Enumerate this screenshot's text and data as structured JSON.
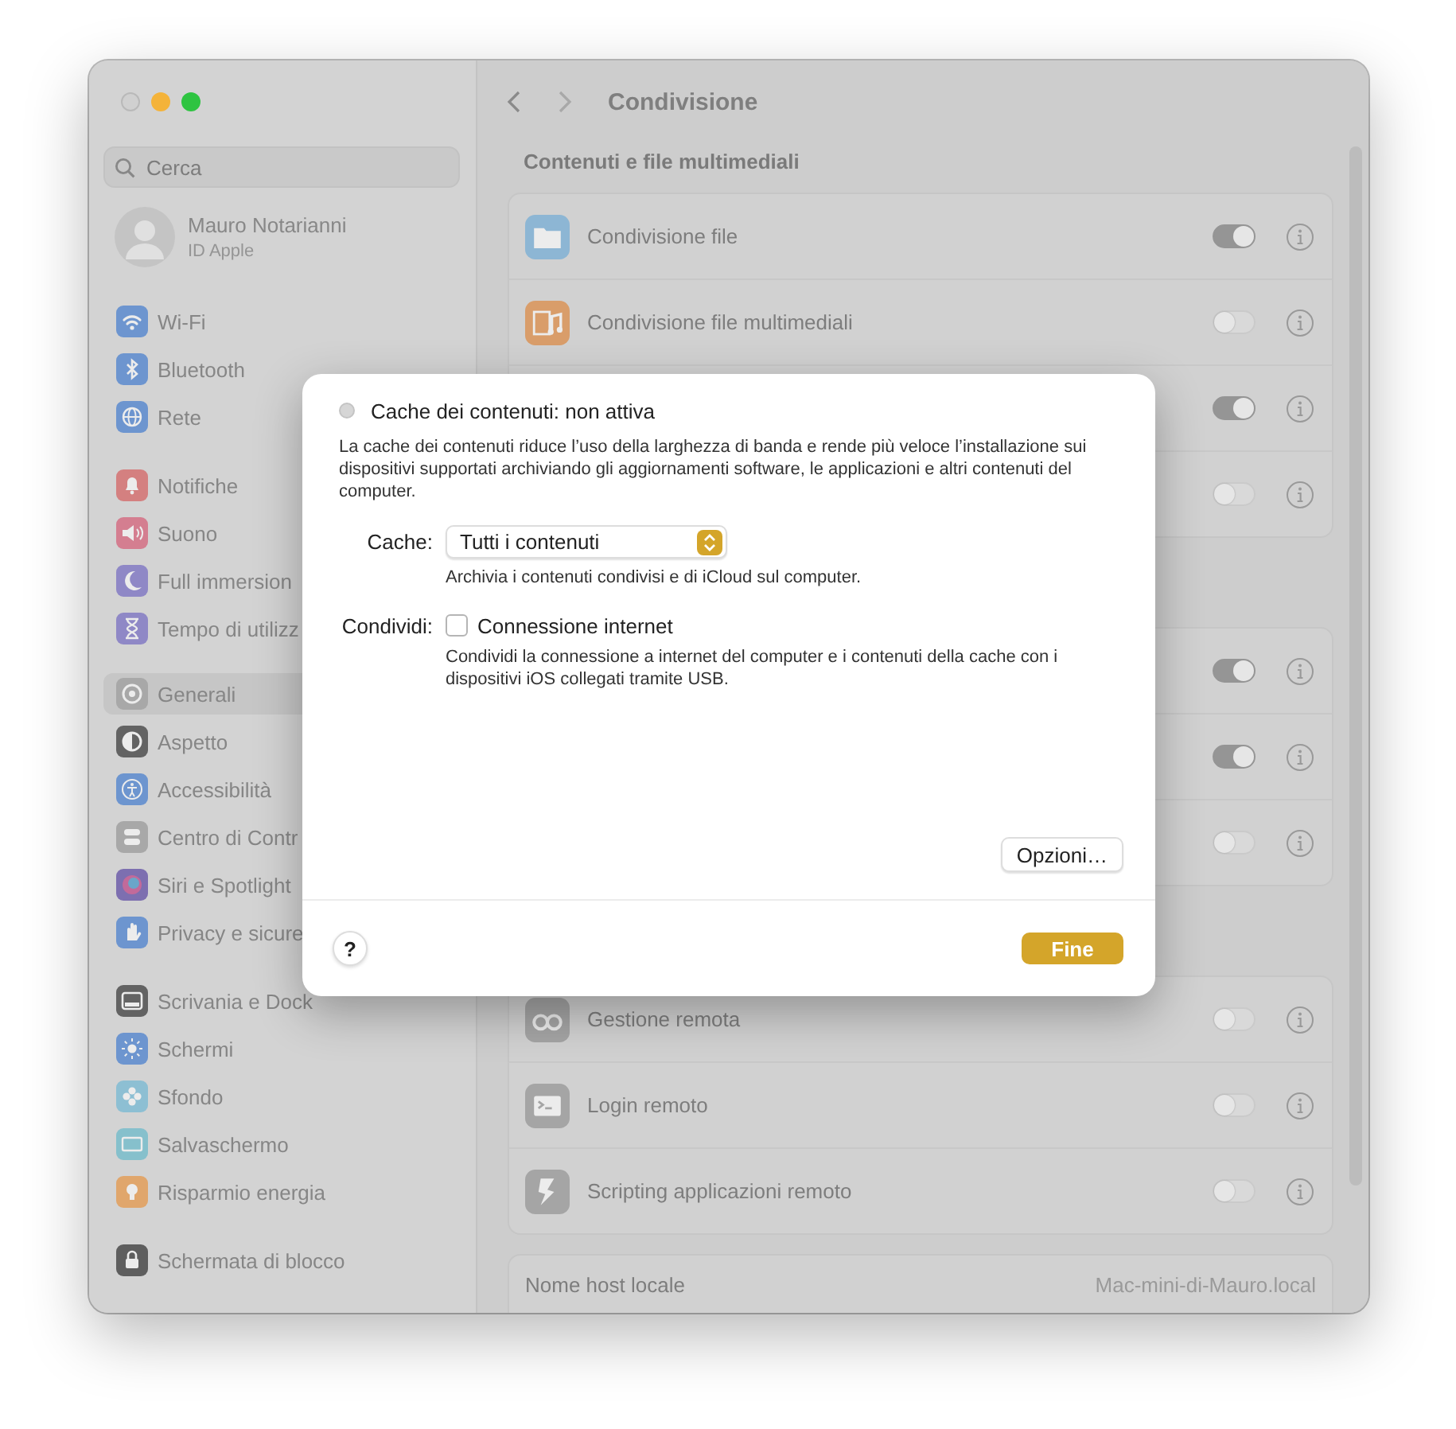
{
  "window": {
    "traffic_lights": [
      {
        "color": "#d0d0d0"
      },
      {
        "color": "#f4b33a"
      },
      {
        "color": "#2ec441"
      }
    ]
  },
  "sidebar": {
    "search": {
      "placeholder": "Cerca"
    },
    "profile": {
      "name": "Mauro Notarianni",
      "subtitle": "ID Apple"
    },
    "groups": [
      {
        "items": [
          {
            "label": "Wi-Fi",
            "selected": false
          },
          {
            "label": "Bluetooth",
            "selected": false
          },
          {
            "label": "Rete",
            "selected": false
          }
        ]
      },
      {
        "items": [
          {
            "label": "Notifiche",
            "selected": false
          },
          {
            "label": "Suono",
            "selected": false
          },
          {
            "label": "Full immersion",
            "selected": false
          },
          {
            "label": "Tempo di utilizz",
            "selected": false
          }
        ]
      },
      {
        "items": [
          {
            "label": "Generali",
            "selected": true
          },
          {
            "label": "Aspetto",
            "selected": false
          },
          {
            "label": "Accessibilità",
            "selected": false
          },
          {
            "label": "Centro di Contr",
            "selected": false
          },
          {
            "label": "Siri e Spotlight",
            "selected": false
          },
          {
            "label": "Privacy e sicure",
            "selected": false
          }
        ]
      },
      {
        "items": [
          {
            "label": "Scrivania e Dock",
            "selected": false
          },
          {
            "label": "Schermi",
            "selected": false
          },
          {
            "label": "Sfondo",
            "selected": false
          },
          {
            "label": "Salvaschermo",
            "selected": false
          },
          {
            "label": "Risparmio energia",
            "selected": false
          }
        ]
      },
      {
        "items": [
          {
            "label": "Schermata di blocco",
            "selected": false
          }
        ]
      }
    ]
  },
  "main": {
    "title": "Condivisione",
    "sections": [
      {
        "heading": "Contenuti e file multimediali",
        "rows": [
          {
            "label": "Condivisione file",
            "on": true
          },
          {
            "label": "Condivisione file multimediali",
            "on": false
          },
          {
            "on": true
          },
          {
            "on": false
          }
        ]
      },
      {
        "rows": [
          {
            "on": true
          },
          {
            "on": true
          },
          {
            "on": false
          }
        ]
      },
      {
        "rows": [
          {
            "label": "Gestione remota",
            "on": false
          },
          {
            "label": "Login remoto",
            "on": false
          },
          {
            "label": "Scripting applicazioni remoto",
            "on": false
          }
        ]
      }
    ],
    "host": {
      "label": "Nome host locale",
      "value": "Mac-mini-di-Mauro.local"
    }
  },
  "sheet": {
    "status": {
      "text": "Cache dei contenuti: non attiva",
      "active": false
    },
    "description": "La cache dei contenuti riduce l’uso della larghezza di banda e rende più veloce l’installazione sui dispositivi supportati archiviando gli aggiornamenti software, le applicazioni e altri contenuti del computer.",
    "cache": {
      "label": "Cache:",
      "value": "Tutti i contenuti",
      "hint": "Archivia i contenuti condivisi e di iCloud sul computer."
    },
    "share": {
      "label": "Condividi:",
      "option": "Connessione internet",
      "checked": false,
      "hint": "Condividi la connessione a internet del computer e i contenuti della cache con i dispositivi iOS collegati tramite USB."
    },
    "options_button": "Opzioni…",
    "help_button": "?",
    "done_button": "Fine"
  }
}
